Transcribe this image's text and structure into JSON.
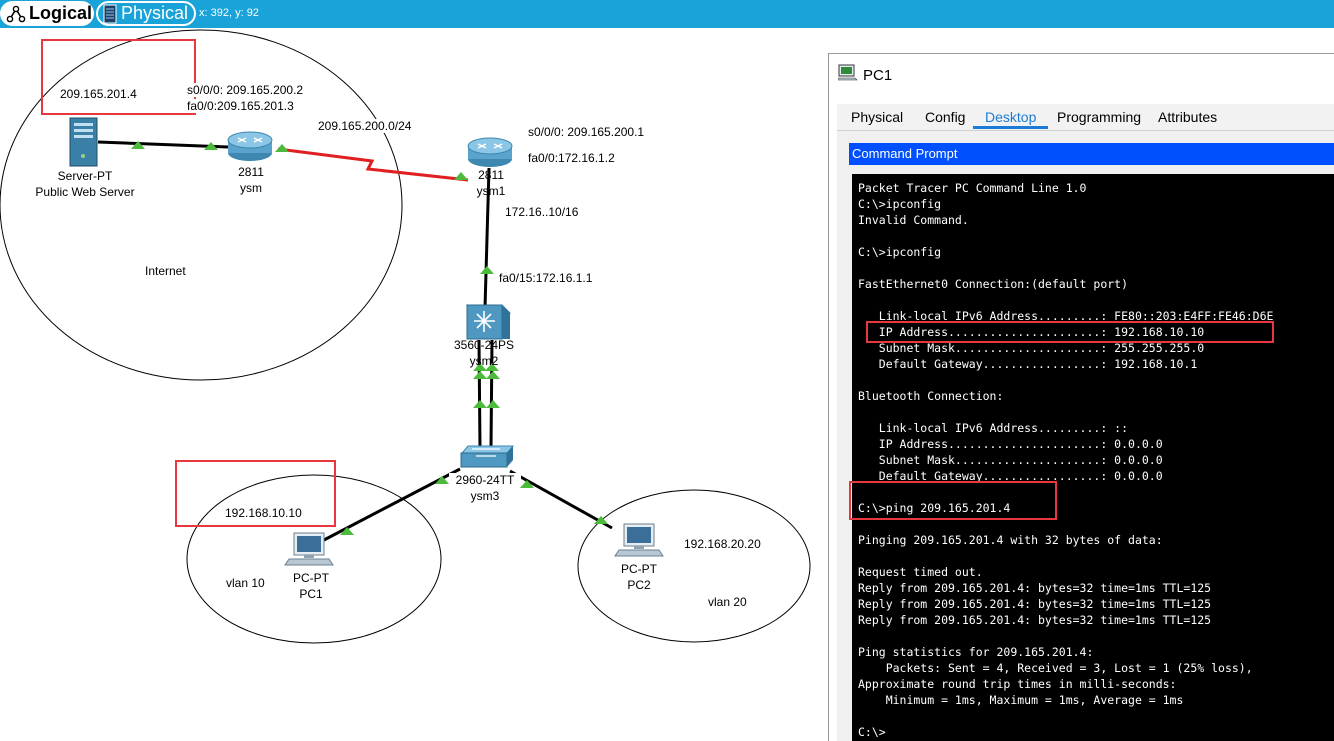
{
  "topbar": {
    "logical_label": "Logical",
    "physical_label": "Physical",
    "coords": "x: 392, y: 92"
  },
  "topology": {
    "server": {
      "model": "Server-PT",
      "name": "Public Web Server"
    },
    "router_ysm": {
      "model": "2811",
      "name": "ysm",
      "if_s0": "s0/0/0: 209.165.200.2",
      "if_fa0": "fa0/0:209.165.201.3"
    },
    "router_ysm1": {
      "model": "2811",
      "name": "ysm1",
      "if_s0": "s0/0/0: 209.165.200.1",
      "if_fa0": "fa0/0:172.16.1.2"
    },
    "serial_link_label": "209.165.200.0/24",
    "lan_label": "172.16..10/16",
    "switch_ysm2": {
      "model": "3560-24PS",
      "name": "ysm2",
      "if_fa": "fa0/15:172.16.1.1"
    },
    "switch_ysm3": {
      "model": "2960-24TT",
      "name": "ysm3"
    },
    "pc1": {
      "model": "PC-PT",
      "name": "PC1",
      "ip": "192.168.10.10",
      "vlan": "vlan 10"
    },
    "pc2": {
      "model": "PC-PT",
      "name": "PC2",
      "ip": "192.168.20.20",
      "vlan": "vlan 20"
    },
    "server_ip": "209.165.201.4",
    "internet_label": "Internet"
  },
  "window": {
    "title": "PC1",
    "tabs": [
      "Physical",
      "Config",
      "Desktop",
      "Programming",
      "Attributes"
    ],
    "active_tab": "Desktop",
    "cmd_title": "Command Prompt",
    "terminal_lines": [
      "Packet Tracer PC Command Line 1.0",
      "C:\\>ipconfig",
      "Invalid Command.",
      "",
      "C:\\>ipconfig",
      "",
      "FastEthernet0 Connection:(default port)",
      "",
      "   Link-local IPv6 Address.........: FE80::203:E4FF:FE46:D6E",
      "   IP Address......................: 192.168.10.10",
      "   Subnet Mask.....................: 255.255.255.0",
      "   Default Gateway.................: 192.168.10.1",
      "",
      "Bluetooth Connection:",
      "",
      "   Link-local IPv6 Address.........: ::",
      "   IP Address......................: 0.0.0.0",
      "   Subnet Mask.....................: 0.0.0.0",
      "   Default Gateway.................: 0.0.0.0",
      "",
      "C:\\>ping 209.165.201.4",
      "",
      "Pinging 209.165.201.4 with 32 bytes of data:",
      "",
      "Request timed out.",
      "Reply from 209.165.201.4: bytes=32 time=1ms TTL=125",
      "Reply from 209.165.201.4: bytes=32 time=1ms TTL=125",
      "Reply from 209.165.201.4: bytes=32 time=1ms TTL=125",
      "",
      "Ping statistics for 209.165.201.4:",
      "    Packets: Sent = 4, Received = 3, Lost = 1 (25% loss),",
      "Approximate round trip times in milli-seconds:",
      "    Minimum = 1ms, Maximum = 1ms, Average = 1ms",
      "",
      "C:\\>"
    ]
  },
  "colors": {
    "topbar": "#1aa3d9",
    "highlight": "#e8383d",
    "serial_link": "#e02020",
    "link_up": "#4cbb3c",
    "cmd_header": "#0050ff"
  }
}
